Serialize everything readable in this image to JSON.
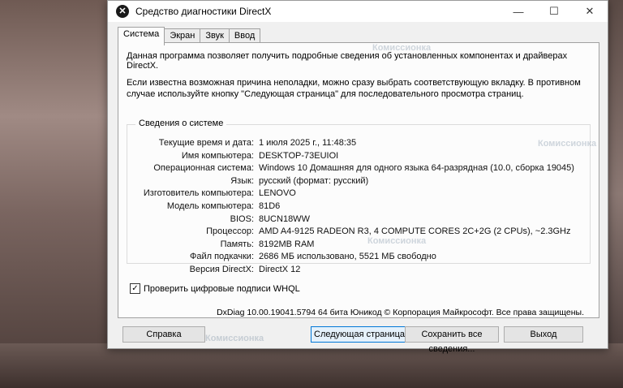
{
  "window": {
    "title": "Средство диагностики DirectX",
    "icon": "directx-icon",
    "controls": {
      "minimize": "—",
      "maximize": "☐",
      "close": "✕"
    }
  },
  "tabs": [
    {
      "label": "Система",
      "active": true
    },
    {
      "label": "Экран",
      "active": false
    },
    {
      "label": "Звук",
      "active": false
    },
    {
      "label": "Ввод",
      "active": false
    }
  ],
  "intro": {
    "line1": "Данная программа позволяет получить подробные сведения об установленных компонентах и драйверах DirectX.",
    "line2": "Если известна возможная причина неполадки, можно сразу выбрать соответствующую вкладку. В противном случае используйте кнопку \"Следующая страница\" для последовательного просмотра страниц."
  },
  "system_info": {
    "group_label": "Сведения о системе",
    "rows": [
      {
        "label": "Текущие время и дата:",
        "value": "1 июля 2025 г., 11:48:35"
      },
      {
        "label": "Имя компьютера:",
        "value": "DESKTOP-73EUIOI"
      },
      {
        "label": "Операционная система:",
        "value": "Windows 10 Домашняя для одного языка 64-разрядная (10.0, сборка 19045)"
      },
      {
        "label": "Язык:",
        "value": "русский (формат: русский)"
      },
      {
        "label": "Изготовитель компьютера:",
        "value": "LENOVO"
      },
      {
        "label": "Модель компьютера:",
        "value": "81D6"
      },
      {
        "label": "BIOS:",
        "value": "8UCN18WW"
      },
      {
        "label": "Процессор:",
        "value": "AMD A4-9125 RADEON R3, 4 COMPUTE CORES 2C+2G    (2 CPUs), ~2.3GHz"
      },
      {
        "label": "Память:",
        "value": "8192MB RAM"
      },
      {
        "label": "Файл подкачки:",
        "value": "2686 МБ использовано, 5521 МБ свободно"
      },
      {
        "label": "Версия DirectX:",
        "value": "DirectX 12"
      }
    ]
  },
  "whql": {
    "label": "Проверить цифровые подписи WHQL",
    "checked": true,
    "mark": "✓"
  },
  "copyright": "DxDiag 10.00.19041.5794 64 бита Юникод  © Корпорация Майкрософт. Все права защищены.",
  "buttons": {
    "help": "Справка",
    "next_page": "Следующая страница",
    "save_all": "Сохранить все сведения...",
    "exit": "Выход"
  },
  "watermark": "Комиссионка"
}
